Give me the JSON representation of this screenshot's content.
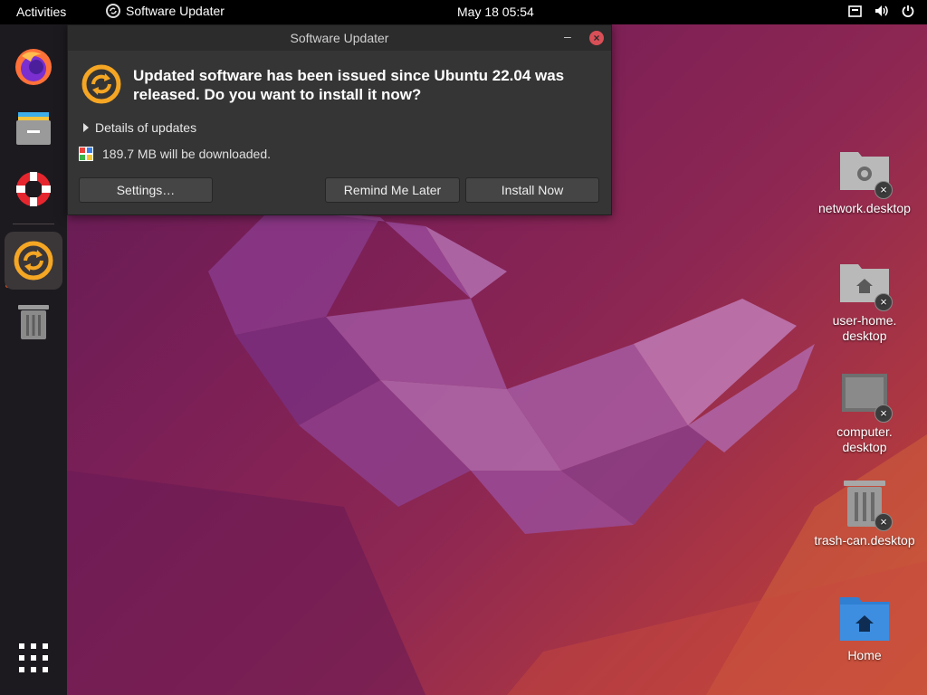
{
  "topbar": {
    "activities": "Activities",
    "app_name": "Software Updater",
    "clock": "May 18  05:54"
  },
  "dock": {
    "items": [
      "firefox-icon",
      "files-icon",
      "help-icon",
      "software-updater-icon",
      "trash-icon"
    ],
    "apps_grid": "show-applications-icon"
  },
  "dialog": {
    "title": "Software Updater",
    "heading_line1": "Updated software has been issued since Ubuntu 22.04 was",
    "heading_line2": "released. Do you want to install it now?",
    "details": "Details of updates",
    "download": "189.7 MB will be downloaded.",
    "buttons": {
      "settings": "Settings…",
      "remind": "Remind Me Later",
      "install": "Install Now"
    }
  },
  "desktop": {
    "icons": [
      {
        "line1": "network.desktop",
        "line2": ""
      },
      {
        "line1": "user-home.",
        "line2": "desktop"
      },
      {
        "line1": "computer.",
        "line2": "desktop"
      },
      {
        "line1": "trash-can.desktop",
        "line2": ""
      },
      {
        "line1": "Home",
        "line2": ""
      }
    ]
  },
  "colors": {
    "accent": "#e95420",
    "dialog_bg": "#353535",
    "folder_blue": "#3d8ee0"
  }
}
